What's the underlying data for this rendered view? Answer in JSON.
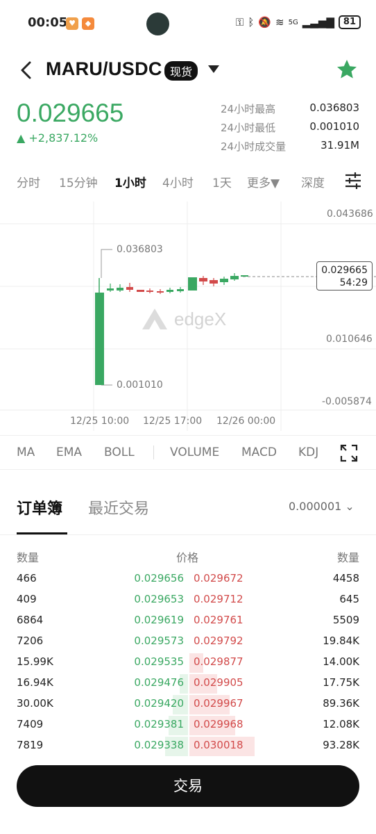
{
  "status_bar": {
    "time": "00:05",
    "network": "5G",
    "battery": "81"
  },
  "header": {
    "pair": "MARU/USDC",
    "market_type": "现货"
  },
  "ticker": {
    "last_price": "0.029665",
    "change": "▲ +2,837.12%",
    "stats": [
      {
        "label": "24小时最高",
        "value": "0.036803"
      },
      {
        "label": "24小时最低",
        "value": "0.001010"
      },
      {
        "label": "24小时成交量",
        "value": "31.91M"
      }
    ]
  },
  "intervals": {
    "items": [
      "分时",
      "15分钟",
      "1小时",
      "4小时",
      "1天",
      "更多▼",
      "深度"
    ],
    "active": "1小时"
  },
  "chart": {
    "y_axis": [
      "0.043686",
      "0.010646",
      "-0.005874"
    ],
    "high_marker": "0.036803",
    "low_marker": "0.001010",
    "current_price": "0.029665",
    "countdown": "54:29",
    "x_axis": [
      "12/25 10:00",
      "12/25 17:00",
      "12/26 00:00"
    ],
    "watermark": "edgeX"
  },
  "chart_data": {
    "type": "candlestick",
    "y_axis_ticks": [
      0.043686,
      0.010646,
      -0.005874
    ],
    "x_axis_ticks": [
      "12/25 10:00",
      "12/25 17:00",
      "12/26 00:00"
    ],
    "high": 0.036803,
    "low": 0.00101,
    "last": 0.029665
  },
  "indicators": [
    "MA",
    "EMA",
    "BOLL",
    "VOLUME",
    "MACD",
    "KDJ"
  ],
  "order_book": {
    "tabs": [
      "订单簿",
      "最近交易"
    ],
    "precision": "0.000001 ⌄",
    "columns": {
      "bid_qty": "数量",
      "price": "价格",
      "ask_qty": "数量"
    },
    "rows": [
      {
        "bid_qty": "466",
        "bid_price": "0.029656",
        "ask_price": "0.029672",
        "ask_qty": "4458"
      },
      {
        "bid_qty": "409",
        "bid_price": "0.029653",
        "ask_price": "0.029712",
        "ask_qty": "645"
      },
      {
        "bid_qty": "6864",
        "bid_price": "0.029619",
        "ask_price": "0.029761",
        "ask_qty": "5509"
      },
      {
        "bid_qty": "7206",
        "bid_price": "0.029573",
        "ask_price": "0.029792",
        "ask_qty": "19.84K"
      },
      {
        "bid_qty": "15.99K",
        "bid_price": "0.029535",
        "ask_price": "0.029877",
        "ask_qty": "14.00K"
      },
      {
        "bid_qty": "16.94K",
        "bid_price": "0.029476",
        "ask_price": "0.029905",
        "ask_qty": "17.75K"
      },
      {
        "bid_qty": "30.00K",
        "bid_price": "0.029420",
        "ask_price": "0.029967",
        "ask_qty": "89.36K"
      },
      {
        "bid_qty": "7409",
        "bid_price": "0.029381",
        "ask_price": "0.029968",
        "ask_qty": "12.08K"
      },
      {
        "bid_qty": "7819",
        "bid_price": "0.029338",
        "ask_price": "0.030018",
        "ask_qty": "93.28K"
      }
    ]
  },
  "trade_button": "交易"
}
